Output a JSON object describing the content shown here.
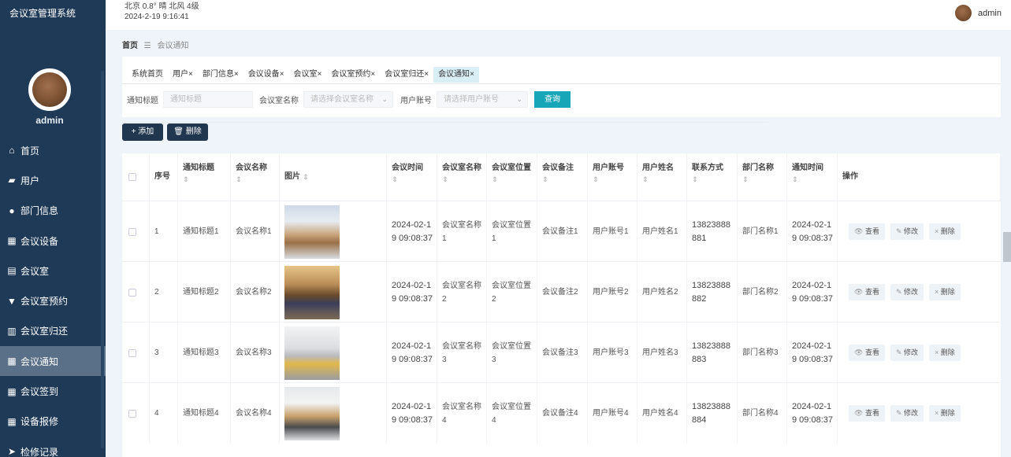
{
  "app": {
    "title": "会议室管理系统"
  },
  "weather": {
    "line": "北京  0.8°  晴  北风  4级",
    "datetime": "2024-2-19 9:16:41"
  },
  "user": {
    "name": "admin"
  },
  "sidebar": {
    "username": "admin",
    "items": [
      {
        "label": "首页",
        "icon": "home-icon"
      },
      {
        "label": "用户",
        "icon": "briefcase-icon"
      },
      {
        "label": "部门信息",
        "icon": "person-icon"
      },
      {
        "label": "会议设备",
        "icon": "grid-icon"
      },
      {
        "label": "会议室",
        "icon": "clipboard-icon"
      },
      {
        "label": "会议室预约",
        "icon": "cup-icon"
      },
      {
        "label": "会议室归还",
        "icon": "bar-chart-icon"
      },
      {
        "label": "会议通知",
        "icon": "grid-icon"
      },
      {
        "label": "会议签到",
        "icon": "grid-icon"
      },
      {
        "label": "设备报修",
        "icon": "grid-icon"
      },
      {
        "label": "检修记录",
        "icon": "send-icon"
      }
    ],
    "active_index": 7
  },
  "breadcrumb": {
    "home": "首页",
    "sep": "☰",
    "current": "会议通知"
  },
  "tabs": [
    {
      "label": "系统首页",
      "close": ""
    },
    {
      "label": "用户",
      "close": "×"
    },
    {
      "label": "部门信息",
      "close": "×"
    },
    {
      "label": "会议设备",
      "close": "×"
    },
    {
      "label": "会议室",
      "close": "×"
    },
    {
      "label": "会议室预约",
      "close": "×"
    },
    {
      "label": "会议室归还",
      "close": "×"
    },
    {
      "label": "会议通知",
      "close": "×"
    }
  ],
  "search": {
    "title_label": "通知标题",
    "title_placeholder": "通知标题",
    "room_label": "会议室名称",
    "room_placeholder": "请选择会议室名称",
    "account_label": "用户账号",
    "account_placeholder": "请选择用户账号",
    "query": "查询"
  },
  "actions": {
    "add": "+ 添加",
    "delete": "删除"
  },
  "table": {
    "headers": [
      "序号",
      "通知标题",
      "会议名称",
      "图片",
      "会议时间",
      "会议室名称",
      "会议室位置",
      "会议备注",
      "用户账号",
      "用户姓名",
      "联系方式",
      "部门名称",
      "通知时间",
      "操作"
    ],
    "rows": [
      {
        "idx": "1",
        "title": "通知标题1",
        "meeting": "会议名称1",
        "time_a": "2024-02-1",
        "time_b": "9 09:08:37",
        "room_a": "会议室名称",
        "room_b": "1",
        "loc_a": "会议室位置",
        "loc_b": "1",
        "note": "会议备注1",
        "account": "用户账号1",
        "name": "用户姓名1",
        "phone_a": "13823888",
        "phone_b": "881",
        "dept": "部门名称1",
        "ntime_a": "2024-02-1",
        "ntime_b": "9 09:08:37"
      },
      {
        "idx": "2",
        "title": "通知标题2",
        "meeting": "会议名称2",
        "time_a": "2024-02-1",
        "time_b": "9 09:08:37",
        "room_a": "会议室名称",
        "room_b": "2",
        "loc_a": "会议室位置",
        "loc_b": "2",
        "note": "会议备注2",
        "account": "用户账号2",
        "name": "用户姓名2",
        "phone_a": "13823888",
        "phone_b": "882",
        "dept": "部门名称2",
        "ntime_a": "2024-02-1",
        "ntime_b": "9 09:08:37"
      },
      {
        "idx": "3",
        "title": "通知标题3",
        "meeting": "会议名称3",
        "time_a": "2024-02-1",
        "time_b": "9 09:08:37",
        "room_a": "会议室名称",
        "room_b": "3",
        "loc_a": "会议室位置",
        "loc_b": "3",
        "note": "会议备注3",
        "account": "用户账号3",
        "name": "用户姓名3",
        "phone_a": "13823888",
        "phone_b": "883",
        "dept": "部门名称3",
        "ntime_a": "2024-02-1",
        "ntime_b": "9 09:08:37"
      },
      {
        "idx": "4",
        "title": "通知标题4",
        "meeting": "会议名称4",
        "time_a": "2024-02-1",
        "time_b": "9 09:08:37",
        "room_a": "会议室名称",
        "room_b": "4",
        "loc_a": "会议室位置",
        "loc_b": "4",
        "note": "会议备注4",
        "account": "用户账号4",
        "name": "用户姓名4",
        "phone_a": "13823888",
        "phone_b": "884",
        "dept": "部门名称4",
        "ntime_a": "2024-02-1",
        "ntime_b": "9 09:08:37"
      }
    ],
    "ops": {
      "view": "查看",
      "edit": "修改",
      "del": "删除"
    }
  }
}
